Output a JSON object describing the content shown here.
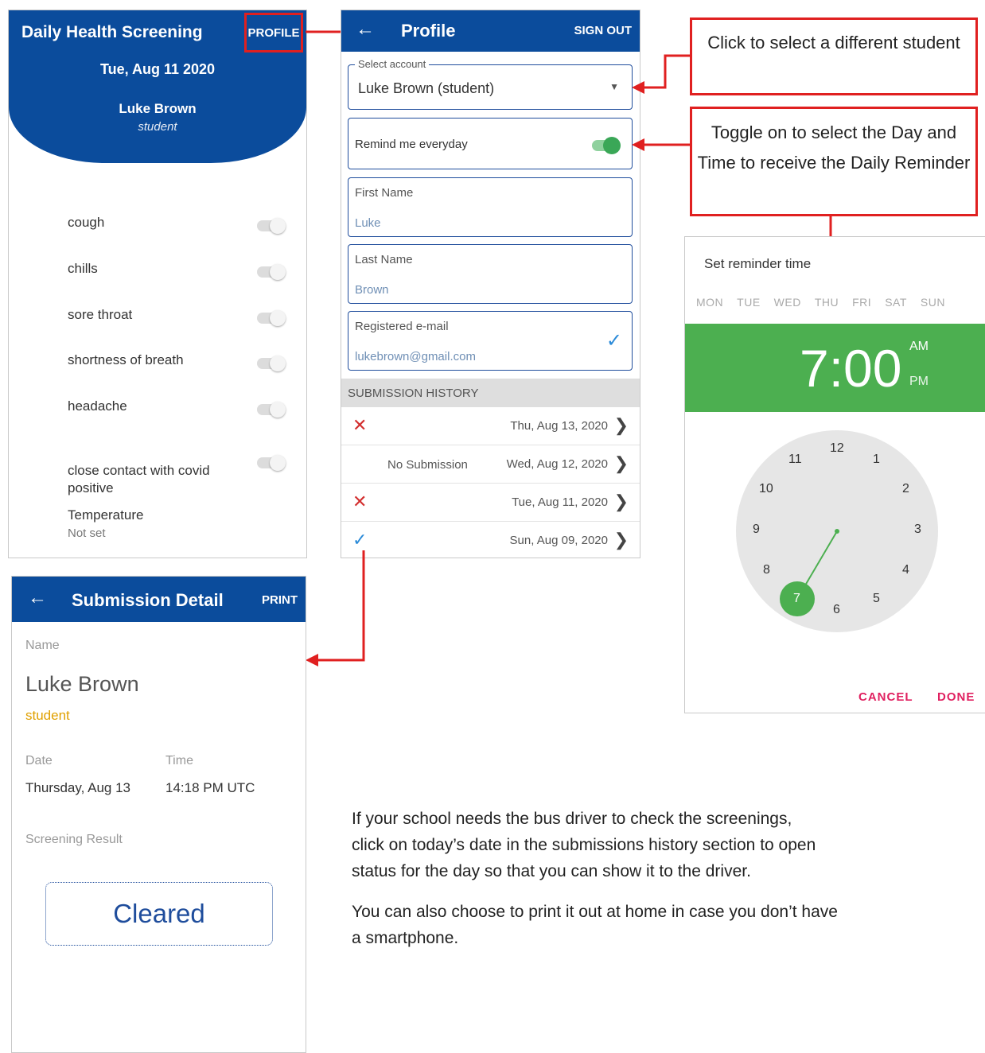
{
  "screening": {
    "title": "Daily Health Screening",
    "profile_button": "PROFILE",
    "date": "Tue, Aug 11 2020",
    "name": "Luke Brown",
    "role": "student",
    "symptoms": [
      "cough",
      "chills",
      "sore throat",
      "shortness of breath",
      "headache",
      "close contact with covid\npositive"
    ],
    "temperature_label": "Temperature",
    "temperature_value": "Not set"
  },
  "profile": {
    "back_icon": "arrow-left-icon",
    "title": "Profile",
    "sign_out": "SIGN OUT",
    "select_account_legend": "Select account",
    "selected_account": "Luke Brown (student)",
    "remind_label": "Remind me everyday",
    "remind_enabled": true,
    "first_name_label": "First Name",
    "first_name_value": "Luke",
    "last_name_label": "Last Name",
    "last_name_value": "Brown",
    "email_label": "Registered e-mail",
    "email_value": "lukebrown@gmail.com",
    "history_header": "SUBMISSION HISTORY",
    "history": [
      {
        "status": "failed",
        "note": "",
        "date": "Thu, Aug 13, 2020"
      },
      {
        "status": "none",
        "note": "No Submission",
        "date": "Wed, Aug 12, 2020"
      },
      {
        "status": "failed",
        "note": "",
        "date": "Tue, Aug 11, 2020"
      },
      {
        "status": "cleared",
        "note": "",
        "date": "Sun, Aug 09, 2020"
      }
    ]
  },
  "callouts": {
    "select_student": "Click to select a different student",
    "toggle_reminder": "Toggle on to select the Day and Time to receive the Daily Reminder"
  },
  "reminder": {
    "label": "Set reminder time",
    "days": [
      "MON",
      "TUE",
      "WED",
      "THU",
      "FRI",
      "SAT",
      "SUN"
    ],
    "time": "7:00",
    "am": "AM",
    "pm": "PM",
    "selected_hour": "7",
    "cancel": "CANCEL",
    "done": "DONE",
    "accent_color": "#4caf50"
  },
  "detail": {
    "title": "Submission Detail",
    "print": "PRINT",
    "name_label": "Name",
    "name": "Luke Brown",
    "role": "student",
    "date_label": "Date",
    "date": "Thursday, Aug 13",
    "time_label": "Time",
    "time": "14:18 PM UTC",
    "result_label": "Screening Result",
    "result": "Cleared"
  },
  "instructions": {
    "line1": "If your school needs the bus driver to check the screenings,",
    "line2": "click on today’s date in the submissions history section to open",
    "line3": "status for the day so that you can show it to the driver.",
    "line4": "You can also choose to print it out at home in case you don’t have",
    "line5": "a smartphone."
  },
  "colors": {
    "brand_blue": "#0b4c9c",
    "annotation_red": "#e02020"
  }
}
